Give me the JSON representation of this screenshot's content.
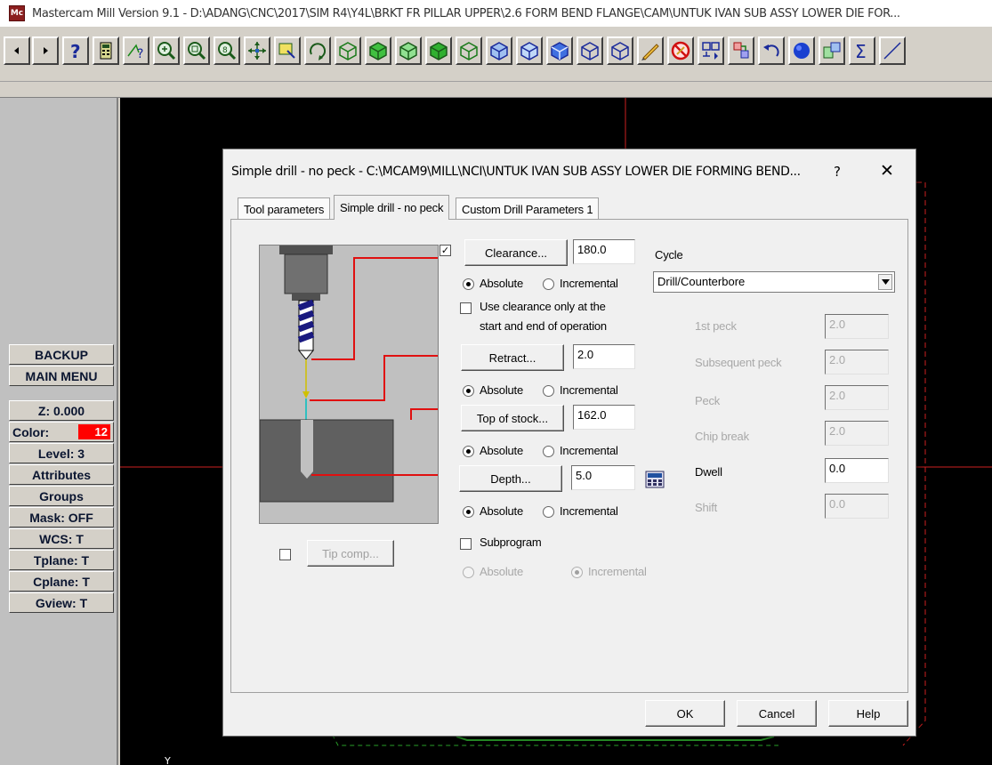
{
  "window": {
    "title": "Mastercam Mill Version 9.1 - D:\\ADANG\\CNC\\2017\\SIM R4\\Y4L\\BRKT FR PILLAR UPPER\\2.6 FORM BEND FLANGE\\CAM\\UNTUK IVAN SUB ASSY LOWER DIE FOR..."
  },
  "toolbar": {
    "icons": [
      "arrow-left-icon",
      "arrow-right-icon",
      "help-icon",
      "calculator-icon",
      "query-icon",
      "zoom-icon",
      "unzoom-icon",
      "zoom-previous-icon",
      "pan-icon",
      "window-select-icon",
      "rotate-icon",
      "view-top-icon",
      "view-front-icon",
      "view-side-icon",
      "view-iso-icon",
      "view-iso2-icon",
      "view-top-shaded-icon",
      "view-dynamic-icon",
      "view-normal-icon",
      "pencil-icon",
      "no-delete-icon",
      "transform-icon",
      "chain-icon",
      "undo-icon",
      "sphere-icon",
      "group-icon",
      "sum-icon",
      "line-icon"
    ]
  },
  "leftpanel": {
    "backup": "BACKUP",
    "main_menu": "MAIN MENU",
    "z": "Z:  0.000",
    "color_label": "Color:",
    "color_value": "12",
    "level": "Level:  3",
    "attributes": "Attributes",
    "groups": "Groups",
    "mask": "Mask:  OFF",
    "wcs": "WCS:  T",
    "tplane": "Tplane:  T",
    "cplane": "Cplane:  T",
    "gview": "Gview:  T"
  },
  "viewport": {
    "axis_label": "Y"
  },
  "dialog": {
    "title": "Simple drill - no peck - C:\\MCAM9\\MILL\\NCI\\UNTUK IVAN SUB ASSY LOWER DIE FORMING BEND...",
    "help_glyph": "?",
    "close_glyph": "✕",
    "tabs": [
      "Tool parameters",
      "Simple drill - no peck",
      "Custom Drill Parameters 1"
    ],
    "clearance": {
      "checked": "✓",
      "label": "Clearance...",
      "value": "180.0"
    },
    "absolute": "Absolute",
    "incremental": "Incremental",
    "use_clearance": "Use clearance only at the",
    "use_clearance2": "start and end of operation",
    "retract": {
      "label": "Retract...",
      "value": "2.0"
    },
    "top_of_stock": {
      "label": "Top of stock...",
      "value": "162.0"
    },
    "depth": {
      "label": "Depth...",
      "value": "5.0"
    },
    "cycle_label": "Cycle",
    "cycle_value": "Drill/Counterbore",
    "first_peck": {
      "label": "1st peck",
      "value": "2.0"
    },
    "subsequent_peck": {
      "label": "Subsequent peck",
      "value": "2.0"
    },
    "peck": {
      "label": "Peck",
      "value": "2.0"
    },
    "chip_break": {
      "label": "Chip break",
      "value": "2.0"
    },
    "dwell": {
      "label": "Dwell",
      "value": "0.0"
    },
    "shift": {
      "label": "Shift",
      "value": "0.0"
    },
    "subprogram": "Subprogram",
    "tip_comp": "Tip comp...",
    "ok": "OK",
    "cancel": "Cancel",
    "help": "Help"
  },
  "colors": {
    "viewport_bg": "#000000",
    "geometry_red": "#cc2020",
    "geometry_green": "#2aa02a",
    "color_swatch": "#ff0000"
  }
}
